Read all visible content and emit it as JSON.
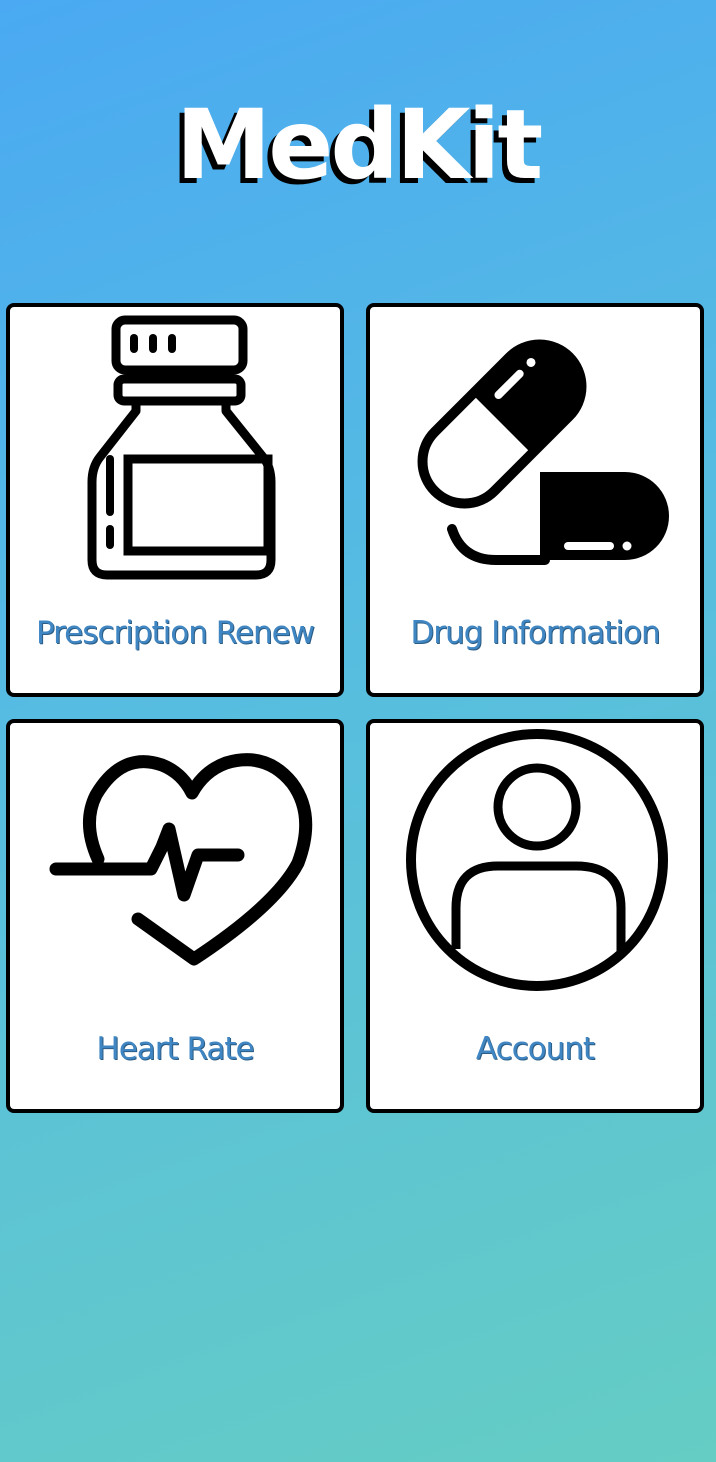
{
  "app": {
    "title": "MedKit"
  },
  "menu": {
    "items": [
      {
        "label": "Prescription Renew",
        "icon": "pill-bottle-icon"
      },
      {
        "label": "Drug Information",
        "icon": "capsules-icon"
      },
      {
        "label": "Heart Rate",
        "icon": "heart-pulse-icon"
      },
      {
        "label": "Account",
        "icon": "user-account-icon"
      }
    ]
  },
  "colors": {
    "label": "#3f86c2",
    "background_top": "#4aa9f2",
    "background_bottom": "#65cdc3"
  }
}
